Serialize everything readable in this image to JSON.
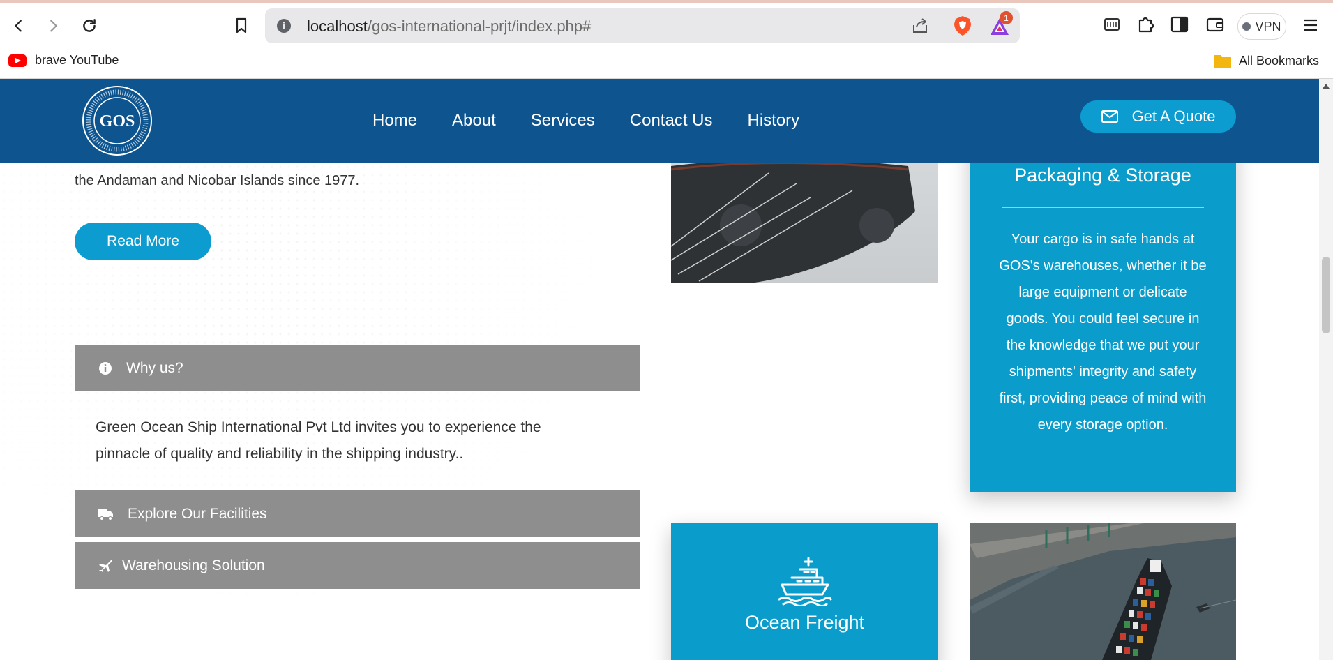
{
  "browser": {
    "address_host": "localhost",
    "address_path": "/gos-international-prjt/index.php#",
    "notification_count": "1",
    "vpn_label": "VPN",
    "bookmarks": [
      {
        "label": "brave YouTube"
      }
    ],
    "all_bookmarks_label": "All Bookmarks"
  },
  "header": {
    "nav": [
      "Home",
      "About",
      "Services",
      "Contact Us",
      "History"
    ],
    "quote_label": "Get A Quote",
    "colors": {
      "bar": "#0e5590",
      "accent": "#0c9cd0"
    }
  },
  "about": {
    "lead_text": "the Andaman and Nicobar Islands since 1977.",
    "read_more_label": "Read More"
  },
  "accordion": {
    "items": [
      {
        "title": "Why us?",
        "icon": "info-circle-icon"
      },
      {
        "title": "Explore Our Facilities",
        "icon": "truck-icon"
      },
      {
        "title": "Warehousing Solution",
        "icon": "plane-icon"
      }
    ],
    "open_text": "Green Ocean Ship International Pvt Ltd invites you to experience the pinnacle of quality and reliability in the shipping industry.."
  },
  "services": {
    "packaging": {
      "title": "Packaging & Storage",
      "text": "Your cargo is in safe hands at GOS's warehouses, whether it be large equipment or delicate goods. You could feel secure in the knowledge that we put your shipments' integrity and safety first, providing peace of mind with every storage option."
    },
    "ocean": {
      "title": "Ocean Freight",
      "icon": "cargo-ship-icon"
    },
    "card_color": "#0a9ccb"
  }
}
